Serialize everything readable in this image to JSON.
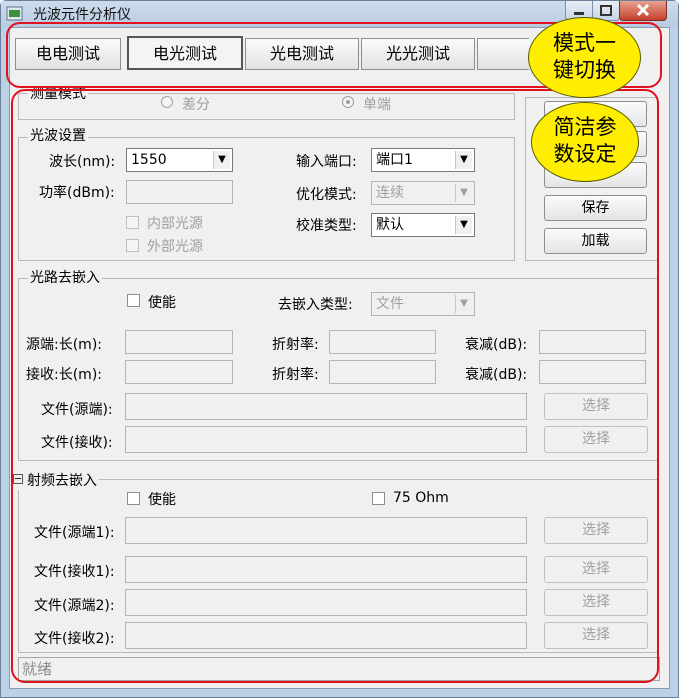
{
  "window": {
    "title": "光波元件分析仪"
  },
  "tabs": [
    {
      "label": "电电测试",
      "active": false
    },
    {
      "label": "电光测试",
      "active": true
    },
    {
      "label": "光电测试",
      "active": false
    },
    {
      "label": "光光测试",
      "active": false
    }
  ],
  "callouts": {
    "mode_switch": [
      "模式一",
      "键切换"
    ],
    "param_setting": [
      "简洁参",
      "数设定"
    ]
  },
  "measure_mode": {
    "legend": "测量模式",
    "options": [
      {
        "label": "差分",
        "checked": false
      },
      {
        "label": "单端",
        "checked": true
      }
    ]
  },
  "optical_settings": {
    "legend": "光波设置",
    "wavelength_label": "波长(nm):",
    "wavelength_value": "1550",
    "power_label": "功率(dBm):",
    "power_value": "",
    "internal_source_label": "内部光源",
    "external_source_label": "外部光源",
    "input_port_label": "输入端口:",
    "input_port_value": "端口1",
    "opt_mode_label": "优化模式:",
    "opt_mode_value": "连续",
    "cal_type_label": "校准类型:",
    "cal_type_value": "默认"
  },
  "side_buttons": {
    "save": "保存",
    "load": "加载"
  },
  "optical_deembed": {
    "legend": "光路去嵌入",
    "enable_label": "使能",
    "type_label": "去嵌入类型:",
    "type_value": "文件",
    "src_len_label": "源端:长(m):",
    "rcv_len_label": "接收:长(m):",
    "refr_label": "折射率:",
    "atten_label": "衰减(dB):",
    "file_src_label": "文件(源端):",
    "file_rcv_label": "文件(接收):",
    "select_label": "选择"
  },
  "rf_deembed": {
    "legend": "射频去嵌入",
    "enable_label": "使能",
    "ohm_label": "75 Ohm",
    "file_src1_label": "文件(源端1):",
    "file_rcv1_label": "文件(接收1):",
    "file_src2_label": "文件(源端2):",
    "file_rcv2_label": "文件(接收2):",
    "select_label": "选择"
  },
  "status": {
    "text": "就绪"
  },
  "colors": {
    "annotation_border": "#e0121e",
    "callout_fill": "#ffee00"
  }
}
